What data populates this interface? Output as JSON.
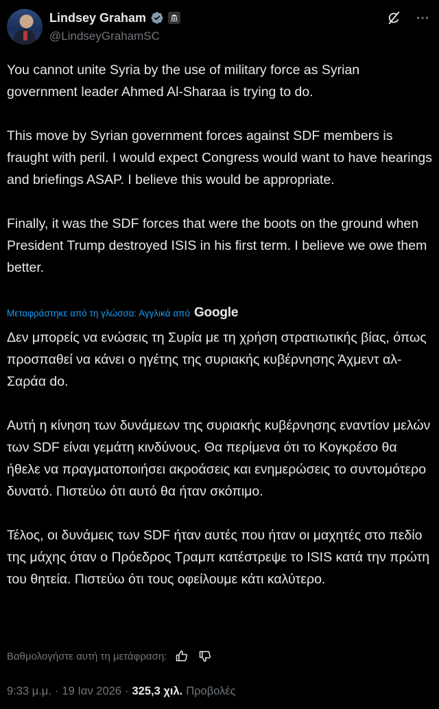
{
  "author": {
    "name": "Lindsey Graham",
    "handle": "@LindseyGrahamSC"
  },
  "icons": {
    "verified": "verified-badge-icon",
    "government": "government-building-icon",
    "grok": "grok-icon",
    "more": "more-icon",
    "thumbs_up": "thumbs-up-icon",
    "thumbs_down": "thumbs-down-icon"
  },
  "colors": {
    "background": "#000000",
    "text": "#e7e9ea",
    "secondary": "#71767b",
    "link": "#1d9bf0",
    "verified": "#829aab"
  },
  "tweet": {
    "paragraphs": [
      "You cannot unite Syria by the use of military force as Syrian government leader Ahmed Al-Sharaa is trying to do.",
      "This move by Syrian government forces against SDF members is fraught with peril. I would expect Congress would want to have hearings and briefings ASAP. I believe this would be appropriate.",
      "Finally, it was the SDF forces that were the boots on the ground when President Trump destroyed ISIS in his first term. I believe we owe them better."
    ]
  },
  "translation": {
    "label": "Μεταφράστηκε από τη γλώσσα: Αγγλικά από",
    "provider": "Google",
    "paragraphs": [
      "Δεν μπορείς να ενώσεις τη Συρία με τη χρήση στρατιωτικής βίας, όπως προσπαθεί να κάνει ο ηγέτης της συριακής κυβέρνησης Άχμεντ αλ-Σαράα do.",
      "Αυτή η κίνηση των δυνάμεων της συριακής κυβέρνησης εναντίον μελών των SDF είναι γεμάτη κινδύνους. Θα περίμενα ότι το Κογκρέσο θα ήθελε να πραγματοποιήσει ακροάσεις και ενημερώσεις το συντομότερο δυνατό. Πιστεύω ότι αυτό θα ήταν σκόπιμο.",
      "Τέλος, οι δυνάμεις των SDF ήταν αυτές που ήταν οι μαχητές στο πεδίο της μάχης όταν ο Πρόεδρος Τραμπ κατέστρεψε το ISIS κατά την πρώτη του θητεία. Πιστεύω ότι τους οφείλουμε κάτι καλύτερο."
    ],
    "rate_label": "Βαθμολογήστε αυτή τη μετάφραση:"
  },
  "meta": {
    "time": "9:33 μ.μ.",
    "separator": "·",
    "date": "19 Ιαν 2026",
    "views_count": "325,3 χιλ.",
    "views_label": "Προβολές"
  }
}
